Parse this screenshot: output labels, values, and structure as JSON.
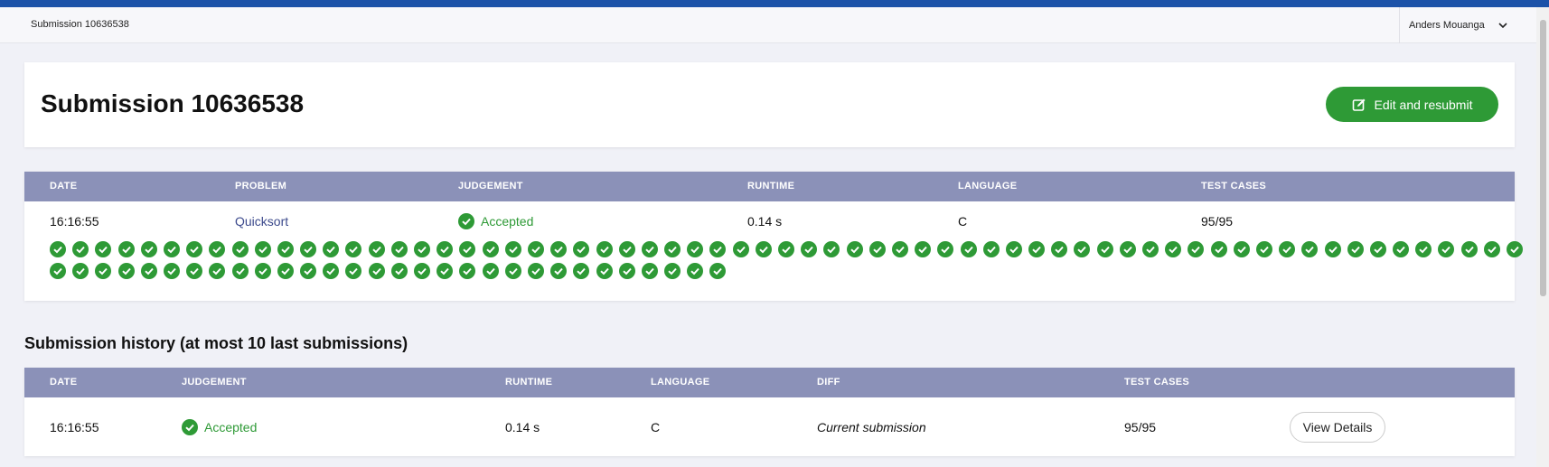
{
  "colors": {
    "accent_blue": "#1c52a8",
    "success_green": "#2e9a36",
    "table_header": "#8b91b8",
    "link": "#3c4a8c"
  },
  "topbar": {
    "breadcrumb": "Submission 10636538",
    "user_name": "Anders Mouanga",
    "user_icon": "chevron-down-icon"
  },
  "header": {
    "title": "Submission 10636538",
    "resubmit_label": "Edit and resubmit",
    "resubmit_icon": "edit-icon"
  },
  "details": {
    "columns": [
      "DATE",
      "PROBLEM",
      "JUDGEMENT",
      "RUNTIME",
      "LANGUAGE",
      "TEST CASES"
    ],
    "row": {
      "date": "16:16:55",
      "problem": "Quicksort",
      "judgement": "Accepted",
      "runtime": "0.14 s",
      "language": "C",
      "test_cases": "95/95"
    },
    "test_case_results": {
      "passed": 95,
      "total": 95,
      "icon": "check-circle-icon"
    }
  },
  "history": {
    "title": "Submission history (at most 10 last submissions)",
    "columns": [
      "DATE",
      "JUDGEMENT",
      "RUNTIME",
      "LANGUAGE",
      "DIFF",
      "TEST CASES"
    ],
    "rows": [
      {
        "date": "16:16:55",
        "judgement": "Accepted",
        "runtime": "0.14 s",
        "language": "C",
        "diff": "Current submission",
        "test_cases": "95/95",
        "action_label": "View Details"
      }
    ]
  }
}
